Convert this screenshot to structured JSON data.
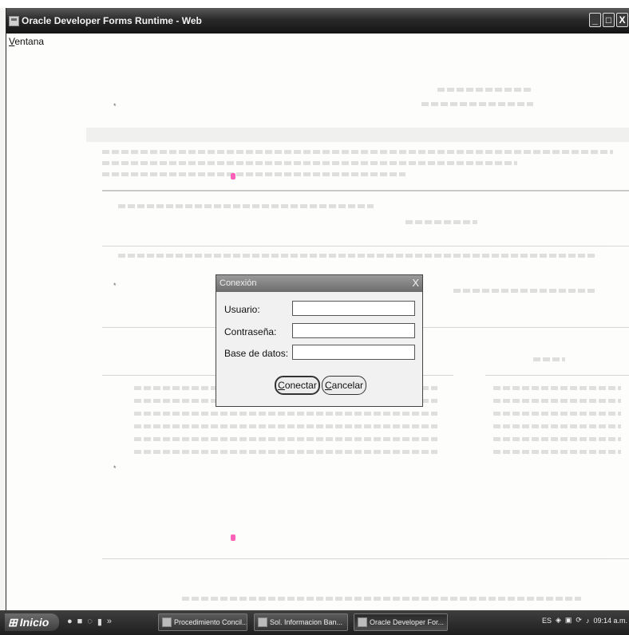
{
  "window": {
    "title": "Oracle Developer Forms Runtime - Web",
    "controls": {
      "minimize": "_",
      "maximize": "□",
      "close": "X"
    }
  },
  "menu": {
    "items": [
      "Ventana"
    ]
  },
  "dialog": {
    "title": "Conexión",
    "close": "X",
    "fields": {
      "user_label": "Usuario:",
      "user_value": "",
      "password_label": "Contraseña:",
      "password_value": "",
      "database_label": "Base de datos:",
      "database_value": ""
    },
    "connect_label": "Conectar",
    "cancel_label": "Cancelar"
  },
  "taskbar": {
    "start_label": "Inicio",
    "tasks": [
      {
        "label": "Procedimiento Concil..."
      },
      {
        "label": "Sol. Informacion Ban..."
      },
      {
        "label": "Oracle Developer For..."
      }
    ],
    "tray": {
      "language": "ES",
      "clock": "09:14 a.m."
    }
  },
  "colors": {
    "titlebar": "#2a2a2a",
    "background": "#fdfdfc",
    "marker": "#ff61b8"
  }
}
